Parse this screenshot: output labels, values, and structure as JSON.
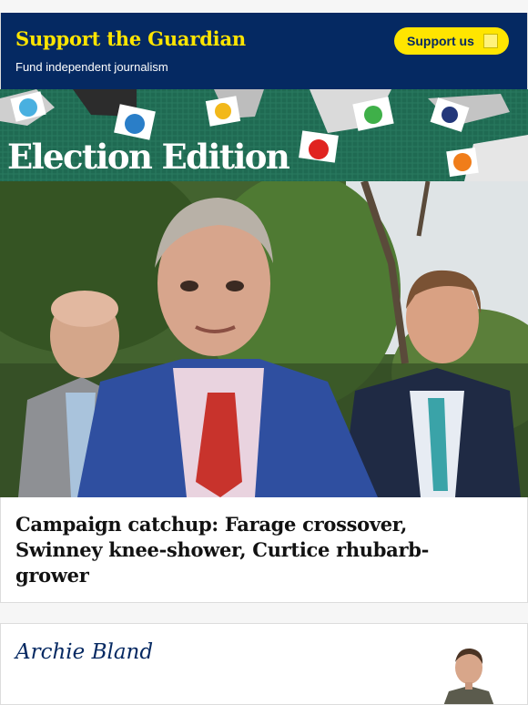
{
  "support": {
    "title": "Support the Guardian",
    "subtitle": "Fund independent journalism",
    "button_label": "Support us",
    "button_icon": "arrow-right-icon",
    "colors": {
      "background": "#052962",
      "accent": "#ffe500"
    }
  },
  "banner": {
    "title": "Election Edition",
    "color": "#1f6a52"
  },
  "hero": {
    "image": "photo-of-three-men-outdoors"
  },
  "article": {
    "headline": "Campaign catchup: Farage crossover, Swinney knee-shower, Curtice rhubarb-grower"
  },
  "author": {
    "name": "Archie Bland",
    "photo": "author-avatar"
  }
}
